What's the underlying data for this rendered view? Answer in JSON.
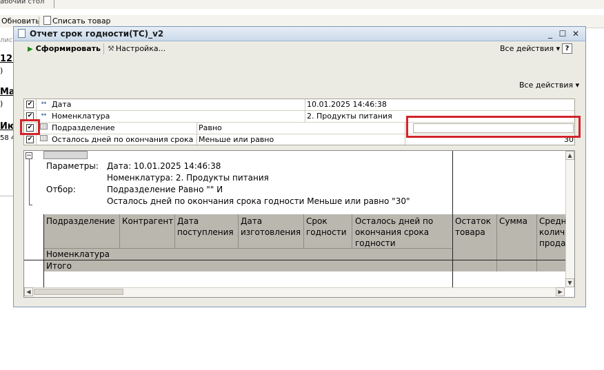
{
  "background_app": {
    "tab_label": "абочий стол",
    "toolbar": {
      "button1": "Обновить",
      "button2": "Списать товар"
    },
    "side_fragments": [
      "лис",
      "12.",
      ")",
      "Ма",
      ")",
      "Ию",
      "58 4"
    ]
  },
  "window": {
    "title": "Отчет срок годности(ТС)_v2",
    "controls": {
      "minimize": "_",
      "maximize": "☐",
      "close": "✕"
    },
    "toolbar": {
      "generate_label": "Сформировать",
      "settings_label": "Настройка...",
      "all_actions_label": "Все действия ▾",
      "help_label": "?"
    },
    "all_actions_label_2": "Все действия ▾"
  },
  "filters": [
    {
      "checked": true,
      "icon": "↔",
      "name": "Дата",
      "condition": "",
      "value": "10.01.2025 14:46:38"
    },
    {
      "checked": true,
      "icon": "↔",
      "name": "Номенклатура",
      "condition": "",
      "value": "2. Продукты питания"
    },
    {
      "checked": true,
      "icon": "",
      "name": "Подразделение",
      "condition": "Равно",
      "value": ""
    },
    {
      "checked": true,
      "icon": "",
      "name": "Осталось дней по окончания срока год...",
      "condition": "Меньше или равно",
      "value": "30"
    }
  ],
  "check_mark": "✔",
  "report": {
    "collapse_symbol": "−",
    "params_label": "Параметры:",
    "param_line1": "Дата: 10.01.2025 14:46:38",
    "param_line2": "Номенклатура: 2. Продукты питания",
    "filter_label": "Отбор:",
    "filter_line1": "Подразделение Равно \"\" И",
    "filter_line2": "Осталось дней по окончания срока годности Меньше или равно \"30\"",
    "columns": {
      "col1": "Подразделение",
      "col2": "Контрагент",
      "col3_l1": "Дата",
      "col3_l2": "поступления",
      "col4_l1": "Дата",
      "col4_l2": "изготовления",
      "col5_l1": "Срок",
      "col5_l2": "годности",
      "col6_l1": "Осталось дней по",
      "col6_l2": "окончания срока",
      "col6_l3": "годности",
      "col7_l1": "Остаток",
      "col7_l2": "товара",
      "col8": "Сумма",
      "col9_l1": "Средн",
      "col9_l2": "количе",
      "col9_l3": "прода:"
    },
    "row_nomenclature": "Номенклатура",
    "row_total": "Итого"
  },
  "colors": {
    "highlight_red": "#d2232a",
    "header_gray": "#b9b7ae",
    "window_border": "#7d97b8"
  }
}
